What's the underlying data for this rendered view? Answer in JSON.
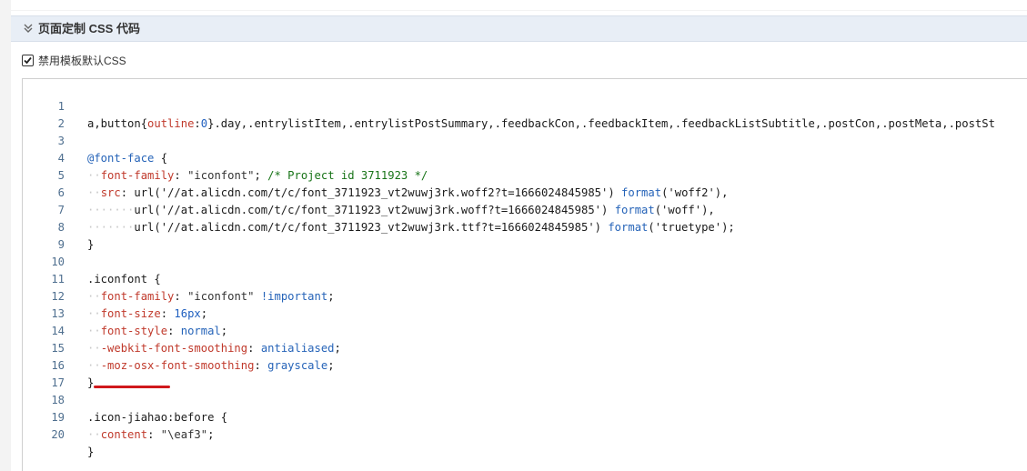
{
  "section": {
    "title": "页面定制 CSS 代码"
  },
  "option": {
    "checked": true,
    "label": "禁用模板默认CSS"
  },
  "colors": {
    "header_bg": "#e8eef6",
    "property": "#c0392b",
    "keyword": "#2563b8",
    "comment": "#177317",
    "annotation": "#d0181c"
  },
  "editor": {
    "lines": [
      {
        "n": "1"
      },
      {
        "n": "2"
      },
      {
        "n": "3"
      },
      {
        "n": "4"
      },
      {
        "n": "5"
      },
      {
        "n": "6"
      },
      {
        "n": "7"
      },
      {
        "n": "8"
      },
      {
        "n": "9"
      },
      {
        "n": "10"
      },
      {
        "n": "11"
      },
      {
        "n": "12"
      },
      {
        "n": "13"
      },
      {
        "n": "14"
      },
      {
        "n": "15"
      },
      {
        "n": "16"
      },
      {
        "n": "17"
      },
      {
        "n": "18"
      },
      {
        "n": "19"
      },
      {
        "n": "20"
      }
    ],
    "l1": {
      "a": "a,button{",
      "b": "outline",
      "c": ":",
      "d": "0",
      "e": "}.day,.entrylistItem,.entrylistPostSummary,.feedbackCon,.feedbackItem,.feedbackListSubtitle,.postCon,.postMeta,.postSt"
    },
    "l3": {
      "a": "@font-face",
      "b": " {"
    },
    "l4": {
      "a": "font-family",
      "b": ": ",
      "c": "\"iconfont\"",
      "d": "; ",
      "e": "/* Project id 3711923 */"
    },
    "l5": {
      "a": "src",
      "b": ": ",
      "c": "url('//at.alicdn.com/t/c/font_3711923_vt2wuwj3rk.woff2?t=1666024845985')",
      "d": " ",
      "e": "format",
      "f": "('woff2'),"
    },
    "l6": {
      "c": "url('//at.alicdn.com/t/c/font_3711923_vt2wuwj3rk.woff?t=1666024845985')",
      "d": " ",
      "e": "format",
      "f": "('woff'),"
    },
    "l7": {
      "c": "url('//at.alicdn.com/t/c/font_3711923_vt2wuwj3rk.ttf?t=1666024845985')",
      "d": " ",
      "e": "format",
      "f": "('truetype');"
    },
    "l8": "}",
    "l10": ".iconfont {",
    "l11": {
      "a": "font-family",
      "b": ": ",
      "c": "\"iconfont\"",
      "d": " ",
      "e": "!important",
      "f": ";"
    },
    "l12": {
      "a": "font-size",
      "b": ": ",
      "c": "16px",
      "d": ";"
    },
    "l13": {
      "a": "font-style",
      "b": ": ",
      "c": "normal",
      "d": ";"
    },
    "l14": {
      "a": "-webkit-font-smoothing",
      "b": ": ",
      "c": "antialiased",
      "d": ";"
    },
    "l15": {
      "a": "-moz-osx-font-smoothing",
      "b": ": ",
      "c": "grayscale",
      "d": ";"
    },
    "l16": "}",
    "l18": ".icon-jiahao:before {",
    "l19": {
      "a": "content",
      "b": ": ",
      "c": "\"\\eaf3\"",
      "d": ";"
    },
    "l20": "}"
  }
}
